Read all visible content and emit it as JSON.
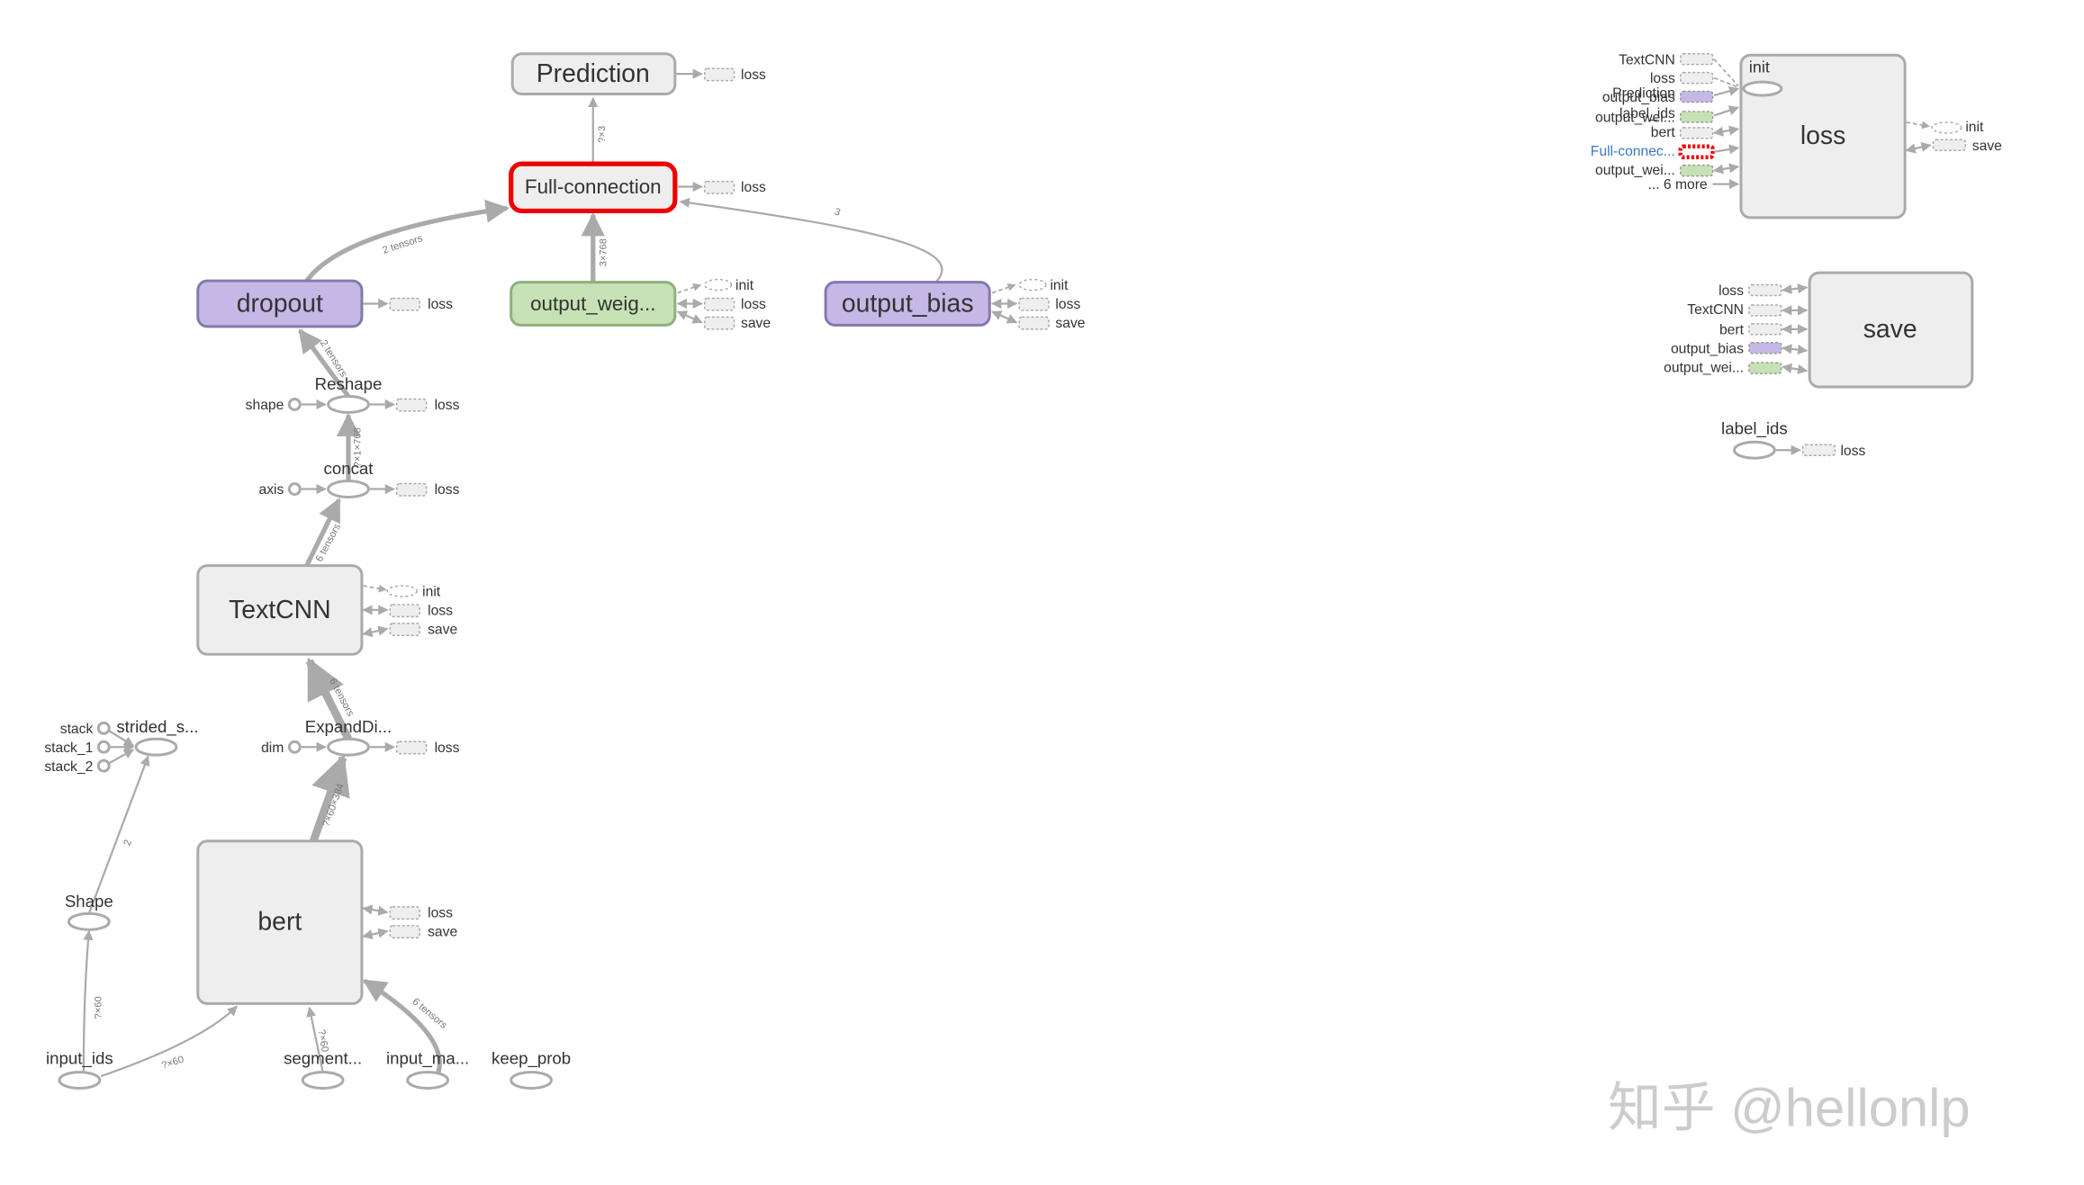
{
  "nodes": {
    "prediction": {
      "label": "Prediction",
      "outputs": [
        "loss"
      ]
    },
    "full_connection": {
      "label": "Full-connection",
      "outputs": [
        "loss"
      ],
      "selected": true
    },
    "dropout": {
      "label": "dropout",
      "outputs": [
        "loss"
      ]
    },
    "output_weights": {
      "label": "output_weig...",
      "outputs": [
        "init",
        "loss",
        "save"
      ]
    },
    "output_bias": {
      "label": "output_bias",
      "outputs": [
        "init",
        "loss",
        "save"
      ]
    },
    "reshape": {
      "label": "Reshape",
      "input": "shape",
      "outputs": [
        "loss"
      ]
    },
    "concat": {
      "label": "concat",
      "input": "axis",
      "outputs": [
        "loss"
      ]
    },
    "textcnn": {
      "label": "TextCNN",
      "outputs": [
        "init",
        "loss",
        "save"
      ]
    },
    "expand_dims": {
      "label": "ExpandDi...",
      "input": "dim",
      "outputs": [
        "loss"
      ]
    },
    "strided_slice": {
      "label": "strided_s...",
      "inputs": [
        "stack",
        "stack_1",
        "stack_2"
      ]
    },
    "shape": {
      "label": "Shape"
    },
    "bert": {
      "label": "bert",
      "outputs": [
        "loss",
        "save"
      ]
    },
    "input_ids": {
      "label": "input_ids"
    },
    "segment_ids": {
      "label": "segment..."
    },
    "input_mask": {
      "label": "input_ma..."
    },
    "keep_prob": {
      "label": "keep_prob"
    },
    "loss": {
      "label": "loss",
      "inner_op": "init",
      "inputs": [
        "TextCNN",
        "loss",
        "Prediction",
        "output_bias",
        "label_ids",
        "output_wei...",
        "bert",
        "Full-connec...",
        "output_wei..."
      ],
      "more": "... 6 more",
      "outputs": [
        "init",
        "save"
      ]
    },
    "save": {
      "label": "save",
      "inputs": [
        "loss",
        "TextCNN",
        "bert",
        "output_bias",
        "output_wei..."
      ]
    },
    "label_ids": {
      "label": "label_ids",
      "outputs": [
        "loss"
      ]
    }
  },
  "edges": {
    "fc_to_prediction": "?×3",
    "dropout_to_fc": "2 tensors",
    "weights_to_fc": "3×768",
    "bias_to_fc": "3",
    "reshape_to_dropout": "2 tensors",
    "concat_to_reshape": "?×1×768",
    "textcnn_to_concat": "6 tensors",
    "expand_to_textcnn": "6 tensors",
    "bert_to_expand": "?×60×384",
    "shape_to_strided": "2",
    "ids_to_shape": "?×60",
    "ids_to_bert": "?×60",
    "segment_to_bert": "?×60",
    "mask_to_bert": "6 tensors"
  },
  "colors": {
    "selected": "#ee0000",
    "variable_purple": "#c5b8e6",
    "variable_green": "#c6e2b5",
    "group": "#eeeeee",
    "link": "#3b78c4"
  },
  "watermark": "知乎 @hellonlp"
}
